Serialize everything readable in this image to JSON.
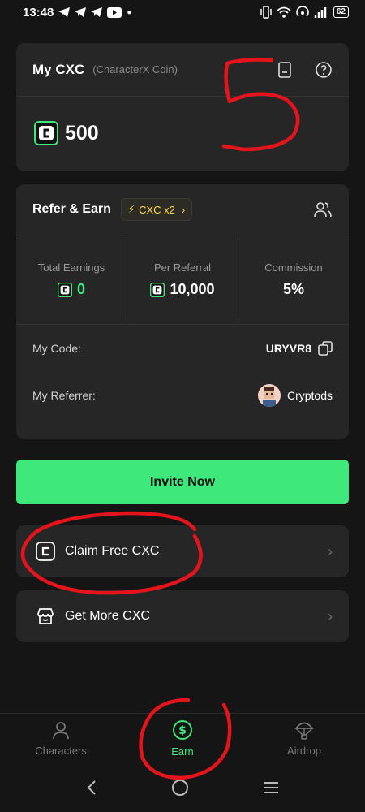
{
  "status_bar": {
    "time": "13:48",
    "battery": "62"
  },
  "my_cxc": {
    "title": "My CXC",
    "subtitle": "(CharacterX Coin)",
    "balance": "500",
    "icons": [
      "ledger-icon",
      "help-circle-icon"
    ]
  },
  "refer": {
    "title": "Refer & Earn",
    "bonus_label": "CXC x2",
    "stats": [
      {
        "label": "Total Earnings",
        "value": "0"
      },
      {
        "label": "Per Referral",
        "value": "10,000"
      },
      {
        "label": "Commission",
        "value": "5%"
      }
    ],
    "my_code_label": "My Code:",
    "my_code": "URYVR8",
    "referrer_label": "My Referrer:",
    "referrer_name": "Cryptods"
  },
  "invite_label": "Invite Now",
  "claim_label": "Claim Free CXC",
  "get_more_label": "Get More CXC",
  "nav": {
    "characters": "Characters",
    "earn": "Earn",
    "airdrop": "Airdrop"
  },
  "colors": {
    "accent": "#3ee87a",
    "card": "#262626",
    "background": "#151515",
    "bonus": "#ffd84a",
    "annotation": "#e3141b"
  }
}
